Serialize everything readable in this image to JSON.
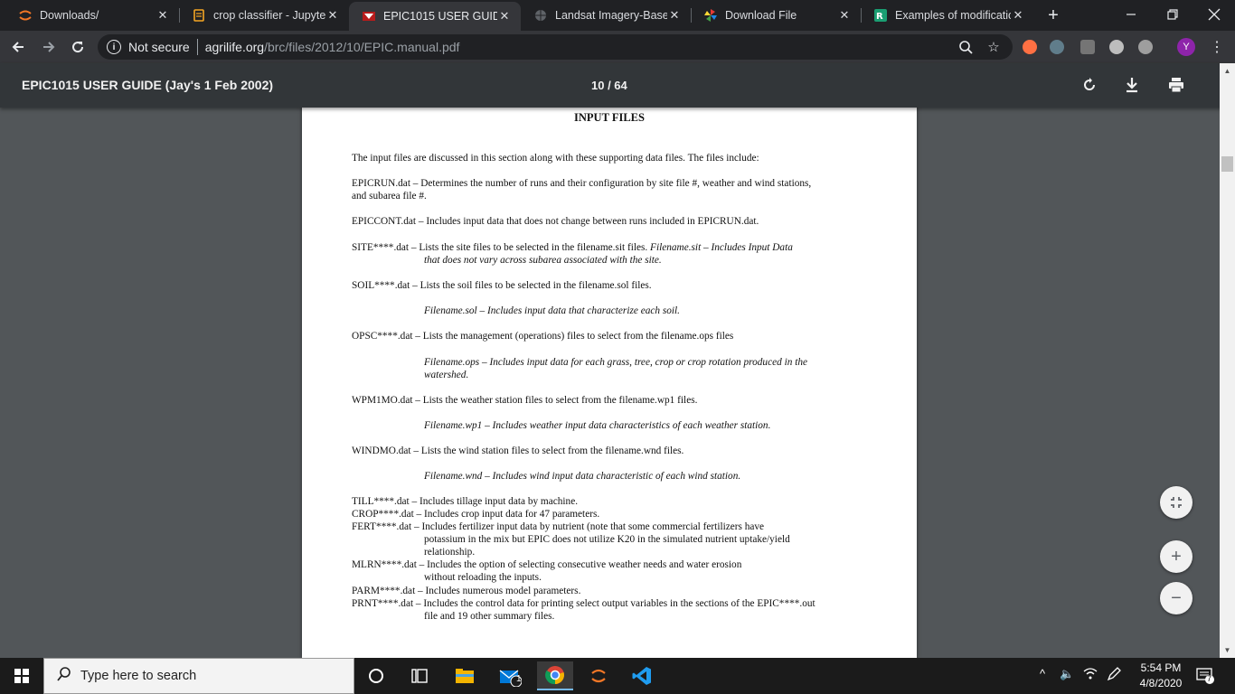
{
  "tabs": [
    {
      "title": "Downloads/",
      "favicon": "jupyter-icon",
      "active": false
    },
    {
      "title": "crop classifier - Jupyter",
      "favicon": "notebook-icon",
      "active": false
    },
    {
      "title": "EPIC1015 USER GUIDE (",
      "favicon": "pdf-logo-icon",
      "active": true
    },
    {
      "title": "Landsat Imagery-Based",
      "favicon": "globe-icon",
      "active": false
    },
    {
      "title": "Download File",
      "favicon": "pinwheel-icon",
      "active": false
    },
    {
      "title": "Examples of modificatio",
      "favicon": "rdocumentation-icon",
      "active": false
    }
  ],
  "address": {
    "security": "Not secure",
    "host": "agrilife.org",
    "path": "/brc/files/2012/10/EPIC.manual.pdf"
  },
  "profile_initial": "Y",
  "pdf": {
    "title": "EPIC1015 USER GUIDE (Jay's 1 Feb 2002)",
    "page_indicator": "10 / 64"
  },
  "document": {
    "heading": "INPUT FILES",
    "intro": "The input files are discussed in this section along with these supporting data files.  The files include:",
    "epicrun_1": "EPICRUN.dat – Determines the number of runs and their configuration by site file #, weather  and wind stations,",
    "epicrun_2": "and subarea file #.",
    "epiccont": "EPICCONT.dat – Includes input data that does not change between runs included in EPICRUN.dat.",
    "site_1a": "SITE****.dat – Lists the site files to be selected in the filename.sit files. ",
    "site_1b": "Filename.sit – Includes Input Data",
    "site_2": "that does not vary across subarea associated with the site.",
    "soil": "SOIL****.dat – Lists the soil files to be selected in the filename.sol files.",
    "soil_sub": "Filename.sol – Includes input data that characterize each soil.",
    "opsc": "OPSC****.dat – Lists the management (operations) files to select from the filename.ops files",
    "opsc_sub_1": "Filename.ops – Includes input data for each grass, tree, crop or crop rotation produced in the",
    "opsc_sub_2": "watershed.",
    "wpm": "WPM1MO.dat – Lists the weather station files to select from the filename.wp1 files.",
    "wpm_sub": "Filename.wp1 – Includes weather input data characteristics of each weather station.",
    "wind": "WINDMO.dat – Lists the wind station files to select from the filename.wnd files.",
    "wind_sub": "Filename.wnd – Includes wind input data characteristic of each wind station.",
    "till": "TILL****.dat – Includes tillage input data by machine.",
    "crop": "CROP****.dat – Includes crop input data for 47 parameters.",
    "fert_1": "FERT****.dat – Includes fertilizer input data by nutrient (note that some commercial fertilizers have",
    "fert_2": "potassium in the mix but EPIC does not utilize K20 in the simulated nutrient uptake/yield",
    "fert_3": "relationship.",
    "mlrn_1": "MLRN****.dat – Includes the option of selecting consecutive weather needs and water erosion",
    "mlrn_2": "without reloading the inputs.",
    "parm": "PARM****.dat – Includes numerous model parameters.",
    "prnt_1": "PRNT****.dat – Includes the control data for printing select output variables in the sections of the EPIC****.out",
    "prnt_2": "file and 19 other summary files."
  },
  "taskbar": {
    "search_placeholder": "Type here to search",
    "mail_badge": "1",
    "time": "5:54 PM",
    "date": "4/8/2020",
    "notification_count": "7"
  }
}
